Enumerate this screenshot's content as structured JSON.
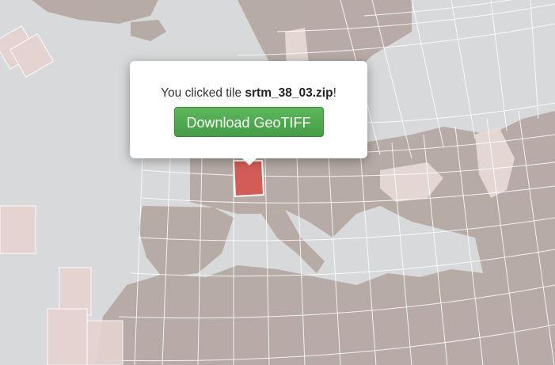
{
  "map": {
    "colors": {
      "ocean": "#d7d9da",
      "land": "#b6a9a4",
      "tile_fill": "#e6d3d1",
      "tile_stroke": "#ffffff",
      "selected_tile": "#d35d56",
      "popup_bg": "#ffffff",
      "button_green": "#4cae4c"
    },
    "selected_tile": "srtm_38_03.zip"
  },
  "popup": {
    "text_prefix": "You clicked tile ",
    "tile_name": "srtm_38_03.zip",
    "text_suffix": "!",
    "button_label": "Download GeoTIFF"
  }
}
